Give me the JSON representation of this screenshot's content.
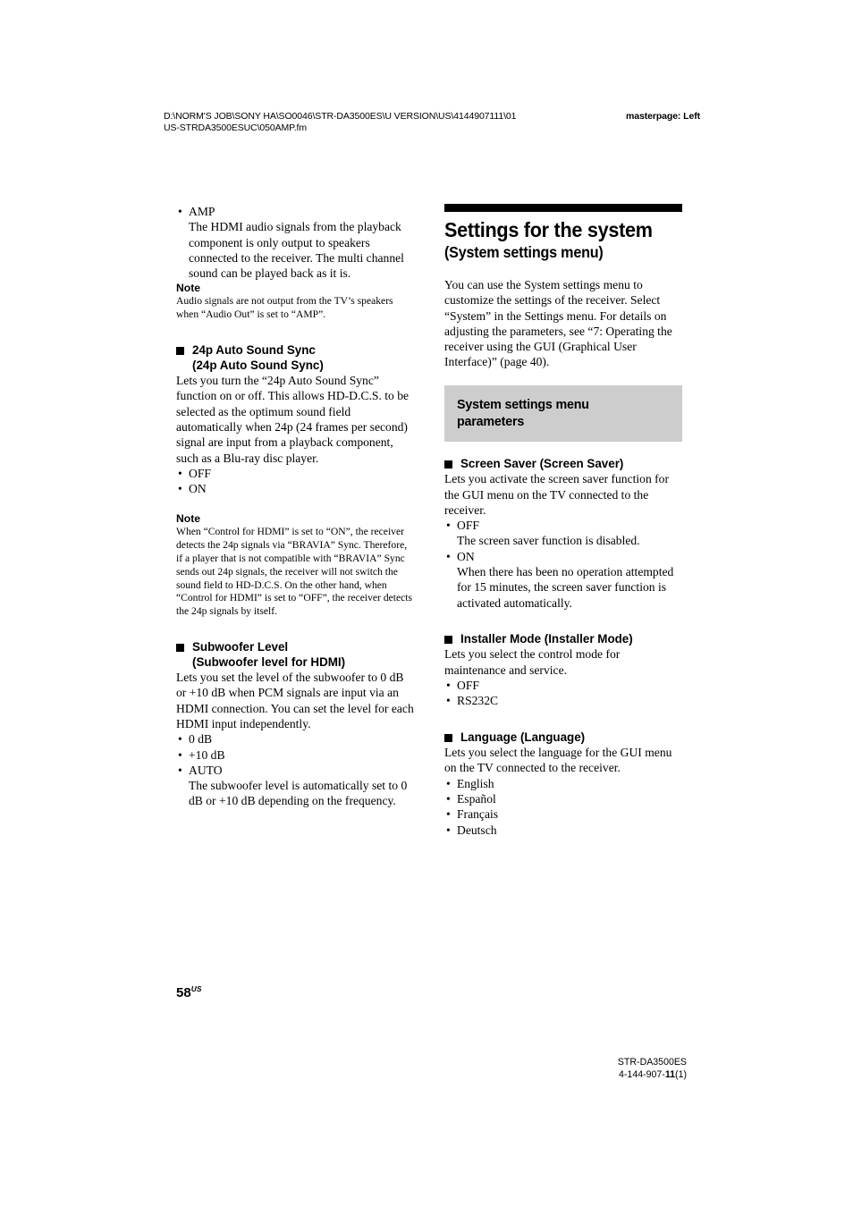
{
  "header": {
    "path": "D:\\NORM'S JOB\\SONY HA\\SO0046\\STR-DA3500ES\\U VERSION\\US\\4144907111\\01US-STRDA3500ESUC\\050AMP.fm",
    "masterpage": "masterpage: Left"
  },
  "left_column": {
    "amp_bullet": "AMP",
    "amp_text": "The HDMI audio signals from the playback component is only output to speakers connected to the receiver. The multi channel sound can be played back as it is.",
    "note1_title": "Note",
    "note1_text": "Audio signals are not output from the TV’s speakers when “Audio Out” is set to “AMP”.",
    "sect_24p_line1": "24p Auto Sound Sync",
    "sect_24p_line2": "(24p Auto Sound Sync)",
    "sect_24p_text": "Lets you turn the “24p Auto Sound Sync” function on or off. This allows HD-D.C.S. to be selected as the optimum sound field automatically when 24p (24 frames per second) signal are input from a playback component, such as a Blu-ray disc player.",
    "sect_24p_options": [
      "OFF",
      "ON"
    ],
    "note2_title": "Note",
    "note2_text": "When “Control for HDMI” is set to “ON”, the receiver detects the 24p signals via “BRAVIA” Sync. Therefore, if a player that is not compatible with “BRAVIA” Sync sends out 24p signals, the receiver will not switch the sound field to HD-D.C.S. On the other hand, when “Control for HDMI” is set to “OFF”, the receiver detects the 24p signals by itself.",
    "sect_sub_line1": "Subwoofer Level",
    "sect_sub_line2": "(Subwoofer level for HDMI)",
    "sect_sub_text": "Lets you set the level of the subwoofer to 0 dB or +10 dB when PCM signals are input via an HDMI connection. You can set the level for each HDMI input independently.",
    "sect_sub_opt1": "0 dB",
    "sect_sub_opt2": "+10 dB",
    "sect_sub_opt3": "AUTO",
    "sect_sub_opt3_desc": "The subwoofer level is automatically set to 0 dB or +10 dB depending on the frequency."
  },
  "right_column": {
    "chapter_title": "Settings for the system",
    "chapter_subtitle": "(System settings menu)",
    "intro": "You can use the System settings menu to customize the settings of the receiver. Select “System” in the Settings menu. For details on adjusting the parameters, see “7: Operating the receiver using the GUI (Graphical User Interface)” (page 40).",
    "gray_head_line1": "System settings menu",
    "gray_head_line2": "parameters",
    "screen_saver_title": "Screen Saver (Screen Saver)",
    "screen_saver_text": "Lets you activate the screen saver function for the GUI menu on the TV connected to the receiver.",
    "screen_saver_opt1": "OFF",
    "screen_saver_opt1_desc": "The screen saver function is disabled.",
    "screen_saver_opt2": "ON",
    "screen_saver_opt2_desc": "When there has been no operation attempted for 15 minutes, the screen saver function is activated automatically.",
    "installer_title": "Installer Mode (Installer Mode)",
    "installer_text": "Lets you select the control mode for maintenance and service.",
    "installer_options": [
      "OFF",
      "RS232C"
    ],
    "language_title": "Language (Language)",
    "language_text": "Lets you select the language for the GUI menu on the TV connected to the receiver.",
    "language_options": [
      "English",
      "Español",
      "Français",
      "Deutsch"
    ]
  },
  "footer": {
    "page_number": "58",
    "page_suffix": "US",
    "model": "STR-DA3500ES",
    "part_prefix": "4-144-907-",
    "part_bold": "11",
    "part_suffix": "(1)"
  },
  "colors": {
    "gray_box": "#cdcdcd",
    "bar": "#000000",
    "text": "#000000",
    "background": "#ffffff"
  }
}
